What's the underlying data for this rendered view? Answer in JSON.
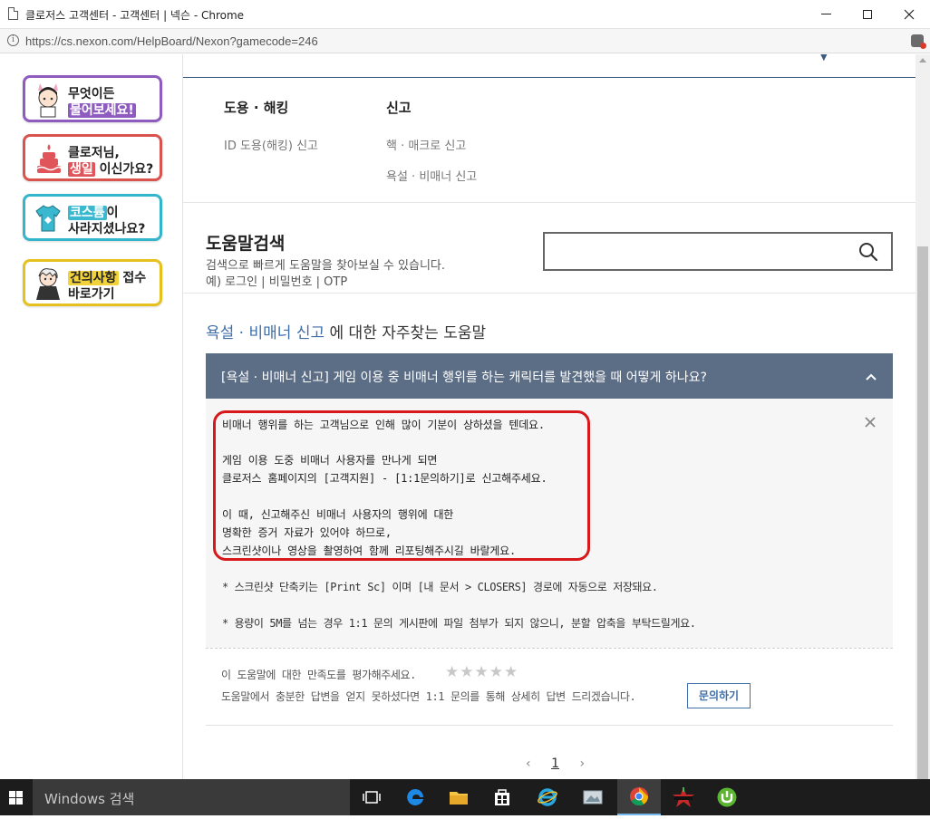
{
  "window": {
    "title": "클로저스 고객센터 - 고객센터 | 넥슨 - Chrome",
    "url": "https://cs.nexon.com/HelpBoard/Nexon?gamecode=246"
  },
  "banners": {
    "ask": {
      "line1": "무엇이든",
      "line2": "물어보세요!"
    },
    "bday": {
      "line1": "클로저님,",
      "line2_hl": "생일",
      "line2_rest": " 이신가요?"
    },
    "costume": {
      "line1_hl": "코스튬",
      "line1_rest": "이",
      "line2": "사라지셨나요?"
    },
    "suggest": {
      "line1_hl": "건의사항",
      "line1_rest": " 접수",
      "line2": "바로가기"
    }
  },
  "categories": [
    {
      "title": "도용 · 해킹",
      "links": [
        "ID 도용(해킹) 신고"
      ]
    },
    {
      "title": "신고",
      "links": [
        "핵 · 매크로 신고",
        "욕설 · 비매너 신고"
      ]
    }
  ],
  "search": {
    "title": "도움말검색",
    "description": "검색으로 빠르게 도움말을 찾아보실 수 있습니다.",
    "example": "예) 로그인 | 비밀번호 | OTP",
    "placeholder": ""
  },
  "faq": {
    "heading_keyword": "욕설 · 비매너 신고",
    "heading_rest": " 에 대한 자주찾는 도움말",
    "question": "[욕설 · 비매너 신고]  게임 이용 중 비매너 행위를 하는 캐릭터를 발견했을 때 어떻게 하나요?",
    "answer_lines": [
      "비매너 행위를 하는 고객님으로 인해 많이 기분이 상하셨을 텐데요.",
      "",
      "게임 이용 도중 비매너 사용자를 만나게 되면",
      "클로저스 홈페이지의 [고객지원] - [1:1문의하기]로 신고해주세요.",
      "",
      "이 때, 신고해주신 비매너 사용자의 행위에 대한",
      "명확한 증거 자료가 있어야 하므로,",
      "스크린샷이나 영상을 촬영하여 함께 리포팅해주시길 바랄게요."
    ],
    "notes": [
      "* 스크린샷 단축키는 [Print Sc] 이며 [내 문서 > CLOSERS] 경로에 자동으로 저장돼요.",
      "* 용량이 5M를 넘는 경우 1:1 문의 게시판에 파일 첨부가 되지 않으니, 분할 압축을 부탁드릴게요."
    ],
    "rating_prompt": "이 도움말에 대한 만족도를 평가해주세요.",
    "stars": "★★★★★",
    "unsolved_text": "도움말에서 충분한 답변을 얻지 못하셨다면 1:1 문의를 통해 상세히 답변 드리겠습니다.",
    "inquiry_button": "문의하기"
  },
  "pagination": {
    "prev": "‹",
    "current": "1",
    "next": "›"
  },
  "taskbar": {
    "search_placeholder": "Windows 검색",
    "apps": [
      "task-view",
      "edge",
      "file-explorer",
      "store",
      "internet-explorer",
      "photos",
      "chrome",
      "closers-game",
      "utorrent"
    ]
  },
  "colors": {
    "accent_blue": "#3f6ea8",
    "faq_bar": "#5c6d86",
    "annotation_red": "#d7191c"
  }
}
